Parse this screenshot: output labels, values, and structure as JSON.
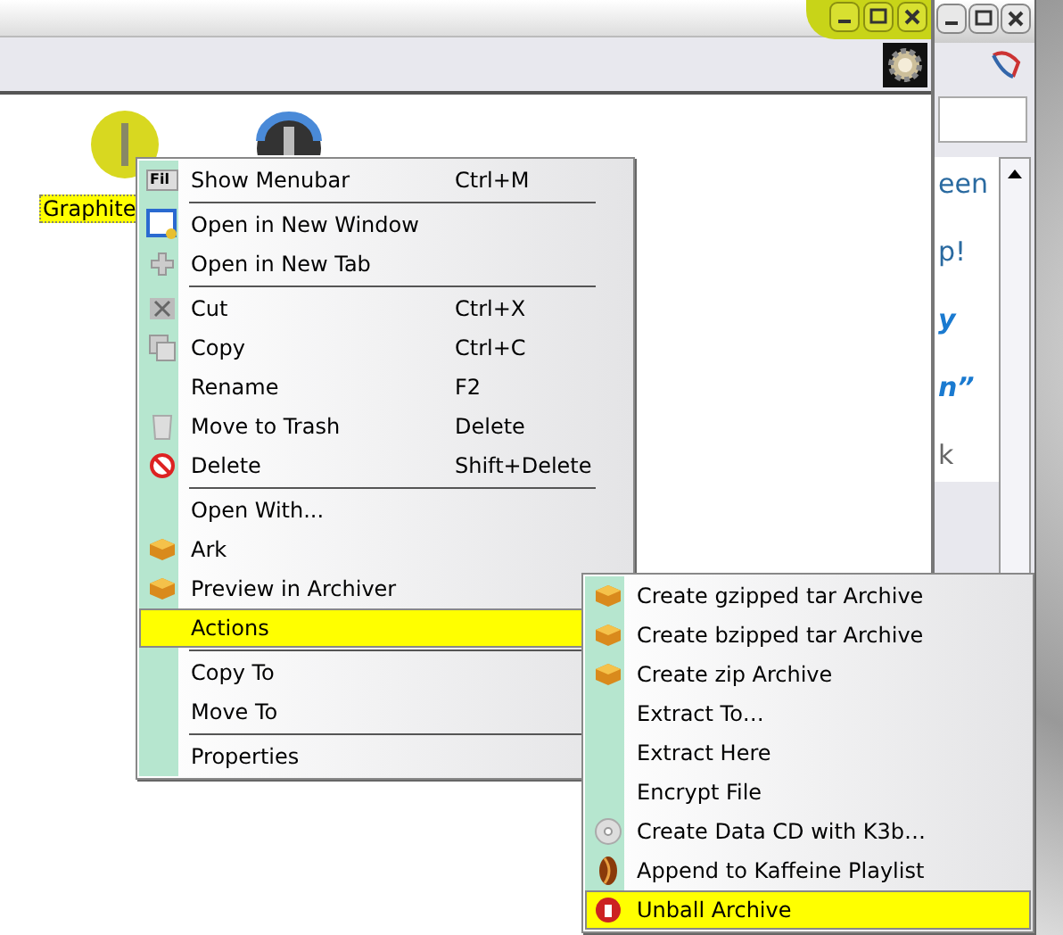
{
  "back_window": {
    "fragments": [
      {
        "text": "een",
        "kind": "link"
      },
      {
        "text": "p!",
        "kind": "link"
      },
      {
        "text": "y",
        "kind": "emphasis"
      },
      {
        "text": "n”",
        "kind": "emphasis"
      },
      {
        "text": "k",
        "kind": "plain"
      }
    ]
  },
  "front_window": {
    "icons": [
      {
        "label": "Graphite",
        "selected": true,
        "kind": "sphere"
      },
      {
        "kind": "drive"
      }
    ]
  },
  "context_menu": {
    "sections": [
      [
        {
          "label": "Show Menubar",
          "shortcut": "Ctrl+M",
          "kind": "menubar",
          "icon_text": "Fil",
          "selected": false
        }
      ],
      [
        {
          "label": "Open in New Window",
          "kind": "window",
          "selected": false
        },
        {
          "label": "Open in New Tab",
          "kind": "tab",
          "selected": false
        }
      ],
      [
        {
          "label": "Cut",
          "shortcut": "Ctrl+X",
          "kind": "cut",
          "selected": false
        },
        {
          "label": "Copy",
          "shortcut": "Ctrl+C",
          "kind": "copy",
          "selected": false
        },
        {
          "label": "Rename",
          "shortcut": "F2",
          "kind": "plain",
          "selected": false
        },
        {
          "label": "Move to Trash",
          "shortcut": "Delete",
          "kind": "trash",
          "selected": false
        },
        {
          "label": "Delete",
          "shortcut": "Shift+Delete",
          "kind": "delete",
          "selected": false
        }
      ],
      [
        {
          "label": "Open With...",
          "kind": "plain",
          "selected": false
        },
        {
          "label": "Ark",
          "kind": "archive",
          "selected": false
        },
        {
          "label": "Preview in Archiver",
          "kind": "archive",
          "selected": false
        },
        {
          "label": "Actions",
          "kind": "plain",
          "selected": true
        }
      ],
      [
        {
          "label": "Copy To",
          "kind": "plain",
          "selected": false
        },
        {
          "label": "Move To",
          "kind": "plain",
          "selected": false
        }
      ],
      [
        {
          "label": "Properties",
          "kind": "plain",
          "selected": false
        }
      ]
    ]
  },
  "actions_submenu": {
    "sections": [
      [
        {
          "label": "Create gzipped tar Archive",
          "kind": "archive",
          "selected": false
        },
        {
          "label": "Create bzipped tar Archive",
          "kind": "archive",
          "selected": false
        },
        {
          "label": "Create zip Archive",
          "kind": "archive",
          "selected": false
        },
        {
          "label": "Extract To…",
          "kind": "plain",
          "selected": false
        },
        {
          "label": "Extract Here",
          "kind": "plain",
          "selected": false
        },
        {
          "label": "Encrypt File",
          "kind": "plain",
          "selected": false
        },
        {
          "label": "Create Data CD with K3b…",
          "kind": "disc",
          "selected": false
        },
        {
          "label": "Append to Kaffeine Playlist",
          "kind": "media",
          "selected": false
        },
        {
          "label": "Unball Archive",
          "kind": "unball",
          "selected": true
        }
      ]
    ]
  }
}
